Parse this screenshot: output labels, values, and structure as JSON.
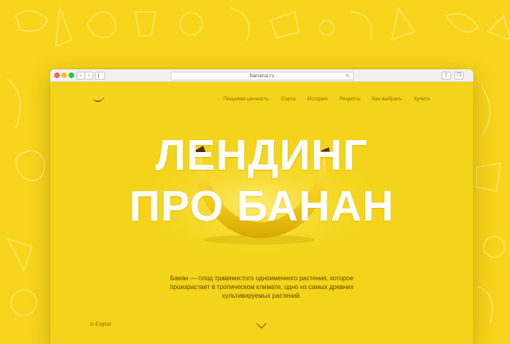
{
  "browser": {
    "url": "banana.ru"
  },
  "nav": {
    "items": [
      "Пищевая ценность",
      "Сорта",
      "История",
      "Рецепты",
      "Как выбрать",
      "Купить"
    ]
  },
  "hero": {
    "line1": "ЛЕНДИНГ",
    "line2": "ПРО БАНАН",
    "description": "Банан — плод травянистого одноименного растения, которое произрастает в тропическом климате, одно из самых древних культивируемых растений."
  },
  "footer": {
    "lang_link": "In English"
  },
  "icons": {
    "logo": "banana-logo-icon",
    "scroll": "chevron-down-icon",
    "reload": "reload-icon",
    "share": "share-icon",
    "tabs": "tabs-icon"
  },
  "colors": {
    "background": "#f7d51c",
    "page": "#f4d41a",
    "headline": "#ffffff",
    "text": "#5a4500"
  }
}
